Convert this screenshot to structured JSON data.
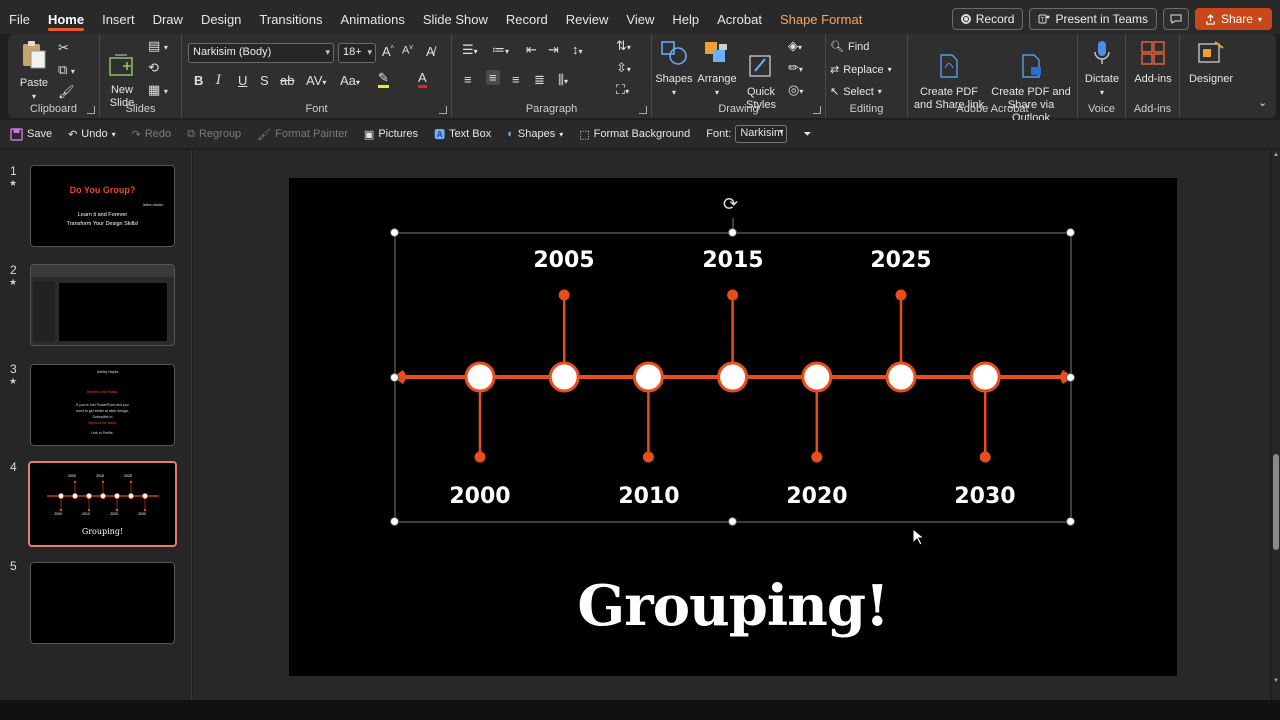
{
  "menu": {
    "tabs": [
      "File",
      "Home",
      "Insert",
      "Draw",
      "Design",
      "Transitions",
      "Animations",
      "Slide Show",
      "Record",
      "Review",
      "View",
      "Help",
      "Acrobat",
      "Shape Format"
    ],
    "active": "Home",
    "record_label": "Record",
    "present_label": "Present in Teams",
    "share_label": "Share"
  },
  "ribbon": {
    "clipboard": {
      "label": "Clipboard",
      "paste": "Paste"
    },
    "slides": {
      "label": "Slides",
      "new_slide": "New\nSlide"
    },
    "font": {
      "label": "Font",
      "family": "Narkisim (Body)",
      "size": "18+"
    },
    "paragraph": {
      "label": "Paragraph"
    },
    "drawing": {
      "label": "Drawing",
      "shapes": "Shapes",
      "arrange": "Arrange",
      "quick_styles": "Quick\nStyles"
    },
    "editing": {
      "label": "Editing",
      "find": "Find",
      "replace": "Replace",
      "select": "Select"
    },
    "acrobat": {
      "label": "Adobe Acrobat",
      "create_share_link": "Create PDF\nand Share link",
      "create_share_outlook": "Create PDF and\nShare via Outlook"
    },
    "voice": {
      "label": "Voice",
      "dictate": "Dictate"
    },
    "addins": {
      "label": "Add-ins",
      "addins": "Add-ins"
    },
    "designer": {
      "label": "Designer"
    }
  },
  "qat": {
    "save": "Save",
    "undo": "Undo",
    "redo": "Redo",
    "regroup": "Regroup",
    "format_painter": "Format Painter",
    "pictures": "Pictures",
    "text_box": "Text Box",
    "shapes": "Shapes",
    "format_background": "Format Background",
    "font_label": "Font:",
    "font_value": "Narkisim"
  },
  "thumbnails": [
    {
      "number": "1",
      "title": "Do You Group?",
      "line1": "Learn it and Forever",
      "line2": "Transform Your Design Skills!",
      "logo": "letter.studio"
    },
    {
      "number": "2"
    },
    {
      "number": "3",
      "brand": "Ashley Hayes",
      "heading": "Beyond the Basic",
      "body1": "If you're into PowerPoint and you",
      "body2": "want to get better at slide design,",
      "body3": "Subscribe to",
      "highlight": "Beyond the Basic",
      "footer": "Link in Profile."
    },
    {
      "number": "4",
      "title": "Grouping!"
    },
    {
      "number": "5"
    }
  ],
  "thumb_years_top": [
    "2005",
    "2015",
    "2025"
  ],
  "thumb_years_bottom": [
    "2000",
    "2010",
    "2020",
    "2030"
  ],
  "slide": {
    "title": "Grouping!",
    "years_top": [
      "2005",
      "2015",
      "2025"
    ],
    "years_bottom": [
      "2000",
      "2010",
      "2020",
      "2030"
    ],
    "accent": "#e84e1b"
  },
  "colors": {
    "accent": "#e84e1b",
    "share": "#c8471a",
    "contextual_tab": "#f5a46a"
  }
}
